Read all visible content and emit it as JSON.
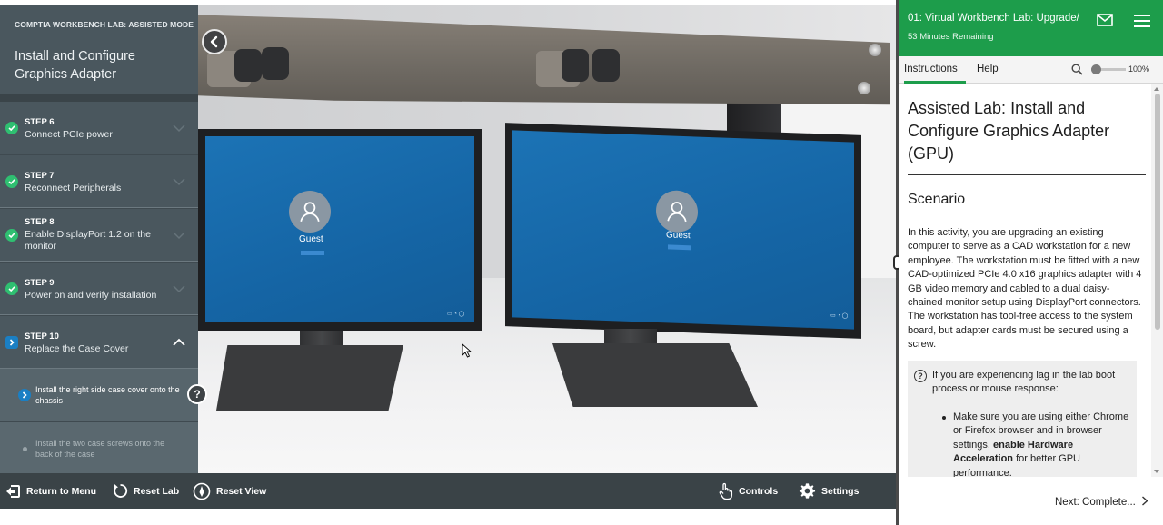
{
  "left_panel": {
    "mode": "COMPTIA WORKBENCH LAB: ASSISTED MODE",
    "title": "Install and Configure Graphics Adapter",
    "steps": [
      {
        "number": "STEP 6",
        "name": "Connect PCIe power",
        "status": "complete"
      },
      {
        "number": "STEP 7",
        "name": "Reconnect Peripherals",
        "status": "complete"
      },
      {
        "number": "STEP 8",
        "name": "Enable DisplayPort 1.2 on the monitor",
        "status": "complete"
      },
      {
        "number": "STEP 9",
        "name": "Power on and verify installation",
        "status": "complete"
      },
      {
        "number": "STEP 10",
        "name": "Replace the Case Cover",
        "status": "current"
      }
    ],
    "substeps": [
      {
        "text": "Install the right side case cover onto the chassis",
        "status": "current"
      },
      {
        "text": "Install the two case screws onto the back of the case",
        "status": "pending"
      }
    ]
  },
  "scene": {
    "monitor_left": {
      "user": "Guest"
    },
    "monitor_right": {
      "user": "Guest"
    }
  },
  "toolbar": {
    "return_label": "Return to Menu",
    "reset_lab_label": "Reset Lab",
    "reset_view_label": "Reset View",
    "controls_label": "Controls",
    "settings_label": "Settings"
  },
  "right_panel": {
    "lab_title": "01: Virtual Workbench Lab: Upgrade/",
    "time_remaining": "53 Minutes Remaining",
    "tabs": [
      "Instructions",
      "Help"
    ],
    "zoom": "100%",
    "heading": "Assisted Lab: Install and Configure Graphics Adapter (GPU)",
    "scenario_heading": "Scenario",
    "scenario_text": "In this activity, you are upgrading an existing computer to serve as a CAD workstation for a new employee. The workstation must be fitted with a new CAD-optimized PCIe 4.0 x16 graphics adapter with 4 GB video memory and cabled to a dual daisy-chained monitor setup using DisplayPort connectors. The workstation has tool-free access to the system board, but adapter cards must be secured using a screw.",
    "note_text": "If you are experiencing lag in the lab boot process or mouse response:",
    "bullet_before": "Make sure you are using either Chrome or Firefox browser and in browser settings, ",
    "bullet_bold": "enable Hardware Acceleration",
    "bullet_after": " for better GPU performance.",
    "next_label": "Next: Complete..."
  },
  "colors": {
    "accent_green": "#1d9d4b",
    "step_check_green": "#2fbf71",
    "panel_slate": "#4a575e",
    "screen_blue": "#1565a5"
  }
}
